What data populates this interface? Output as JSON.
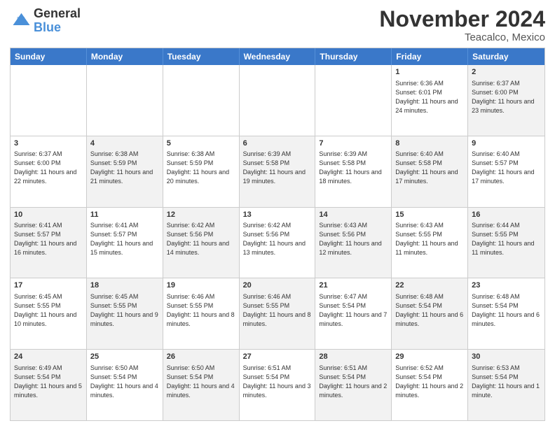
{
  "logo": {
    "line1": "General",
    "line2": "Blue"
  },
  "title": "November 2024",
  "subtitle": "Teacalco, Mexico",
  "header_days": [
    "Sunday",
    "Monday",
    "Tuesday",
    "Wednesday",
    "Thursday",
    "Friday",
    "Saturday"
  ],
  "rows": [
    [
      {
        "day": "",
        "info": "",
        "shade": false,
        "empty": true
      },
      {
        "day": "",
        "info": "",
        "shade": false,
        "empty": true
      },
      {
        "day": "",
        "info": "",
        "shade": false,
        "empty": true
      },
      {
        "day": "",
        "info": "",
        "shade": false,
        "empty": true
      },
      {
        "day": "",
        "info": "",
        "shade": false,
        "empty": true
      },
      {
        "day": "1",
        "info": "Sunrise: 6:36 AM\nSunset: 6:01 PM\nDaylight: 11 hours and 24 minutes.",
        "shade": false
      },
      {
        "day": "2",
        "info": "Sunrise: 6:37 AM\nSunset: 6:00 PM\nDaylight: 11 hours and 23 minutes.",
        "shade": true
      }
    ],
    [
      {
        "day": "3",
        "info": "Sunrise: 6:37 AM\nSunset: 6:00 PM\nDaylight: 11 hours and 22 minutes.",
        "shade": false
      },
      {
        "day": "4",
        "info": "Sunrise: 6:38 AM\nSunset: 5:59 PM\nDaylight: 11 hours and 21 minutes.",
        "shade": true
      },
      {
        "day": "5",
        "info": "Sunrise: 6:38 AM\nSunset: 5:59 PM\nDaylight: 11 hours and 20 minutes.",
        "shade": false
      },
      {
        "day": "6",
        "info": "Sunrise: 6:39 AM\nSunset: 5:58 PM\nDaylight: 11 hours and 19 minutes.",
        "shade": true
      },
      {
        "day": "7",
        "info": "Sunrise: 6:39 AM\nSunset: 5:58 PM\nDaylight: 11 hours and 18 minutes.",
        "shade": false
      },
      {
        "day": "8",
        "info": "Sunrise: 6:40 AM\nSunset: 5:58 PM\nDaylight: 11 hours and 17 minutes.",
        "shade": true
      },
      {
        "day": "9",
        "info": "Sunrise: 6:40 AM\nSunset: 5:57 PM\nDaylight: 11 hours and 17 minutes.",
        "shade": false
      }
    ],
    [
      {
        "day": "10",
        "info": "Sunrise: 6:41 AM\nSunset: 5:57 PM\nDaylight: 11 hours and 16 minutes.",
        "shade": true
      },
      {
        "day": "11",
        "info": "Sunrise: 6:41 AM\nSunset: 5:57 PM\nDaylight: 11 hours and 15 minutes.",
        "shade": false
      },
      {
        "day": "12",
        "info": "Sunrise: 6:42 AM\nSunset: 5:56 PM\nDaylight: 11 hours and 14 minutes.",
        "shade": true
      },
      {
        "day": "13",
        "info": "Sunrise: 6:42 AM\nSunset: 5:56 PM\nDaylight: 11 hours and 13 minutes.",
        "shade": false
      },
      {
        "day": "14",
        "info": "Sunrise: 6:43 AM\nSunset: 5:56 PM\nDaylight: 11 hours and 12 minutes.",
        "shade": true
      },
      {
        "day": "15",
        "info": "Sunrise: 6:43 AM\nSunset: 5:55 PM\nDaylight: 11 hours and 11 minutes.",
        "shade": false
      },
      {
        "day": "16",
        "info": "Sunrise: 6:44 AM\nSunset: 5:55 PM\nDaylight: 11 hours and 11 minutes.",
        "shade": true
      }
    ],
    [
      {
        "day": "17",
        "info": "Sunrise: 6:45 AM\nSunset: 5:55 PM\nDaylight: 11 hours and 10 minutes.",
        "shade": false
      },
      {
        "day": "18",
        "info": "Sunrise: 6:45 AM\nSunset: 5:55 PM\nDaylight: 11 hours and 9 minutes.",
        "shade": true
      },
      {
        "day": "19",
        "info": "Sunrise: 6:46 AM\nSunset: 5:55 PM\nDaylight: 11 hours and 8 minutes.",
        "shade": false
      },
      {
        "day": "20",
        "info": "Sunrise: 6:46 AM\nSunset: 5:55 PM\nDaylight: 11 hours and 8 minutes.",
        "shade": true
      },
      {
        "day": "21",
        "info": "Sunrise: 6:47 AM\nSunset: 5:54 PM\nDaylight: 11 hours and 7 minutes.",
        "shade": false
      },
      {
        "day": "22",
        "info": "Sunrise: 6:48 AM\nSunset: 5:54 PM\nDaylight: 11 hours and 6 minutes.",
        "shade": true
      },
      {
        "day": "23",
        "info": "Sunrise: 6:48 AM\nSunset: 5:54 PM\nDaylight: 11 hours and 6 minutes.",
        "shade": false
      }
    ],
    [
      {
        "day": "24",
        "info": "Sunrise: 6:49 AM\nSunset: 5:54 PM\nDaylight: 11 hours and 5 minutes.",
        "shade": true
      },
      {
        "day": "25",
        "info": "Sunrise: 6:50 AM\nSunset: 5:54 PM\nDaylight: 11 hours and 4 minutes.",
        "shade": false
      },
      {
        "day": "26",
        "info": "Sunrise: 6:50 AM\nSunset: 5:54 PM\nDaylight: 11 hours and 4 minutes.",
        "shade": true
      },
      {
        "day": "27",
        "info": "Sunrise: 6:51 AM\nSunset: 5:54 PM\nDaylight: 11 hours and 3 minutes.",
        "shade": false
      },
      {
        "day": "28",
        "info": "Sunrise: 6:51 AM\nSunset: 5:54 PM\nDaylight: 11 hours and 2 minutes.",
        "shade": true
      },
      {
        "day": "29",
        "info": "Sunrise: 6:52 AM\nSunset: 5:54 PM\nDaylight: 11 hours and 2 minutes.",
        "shade": false
      },
      {
        "day": "30",
        "info": "Sunrise: 6:53 AM\nSunset: 5:54 PM\nDaylight: 11 hours and 1 minute.",
        "shade": true
      }
    ]
  ]
}
